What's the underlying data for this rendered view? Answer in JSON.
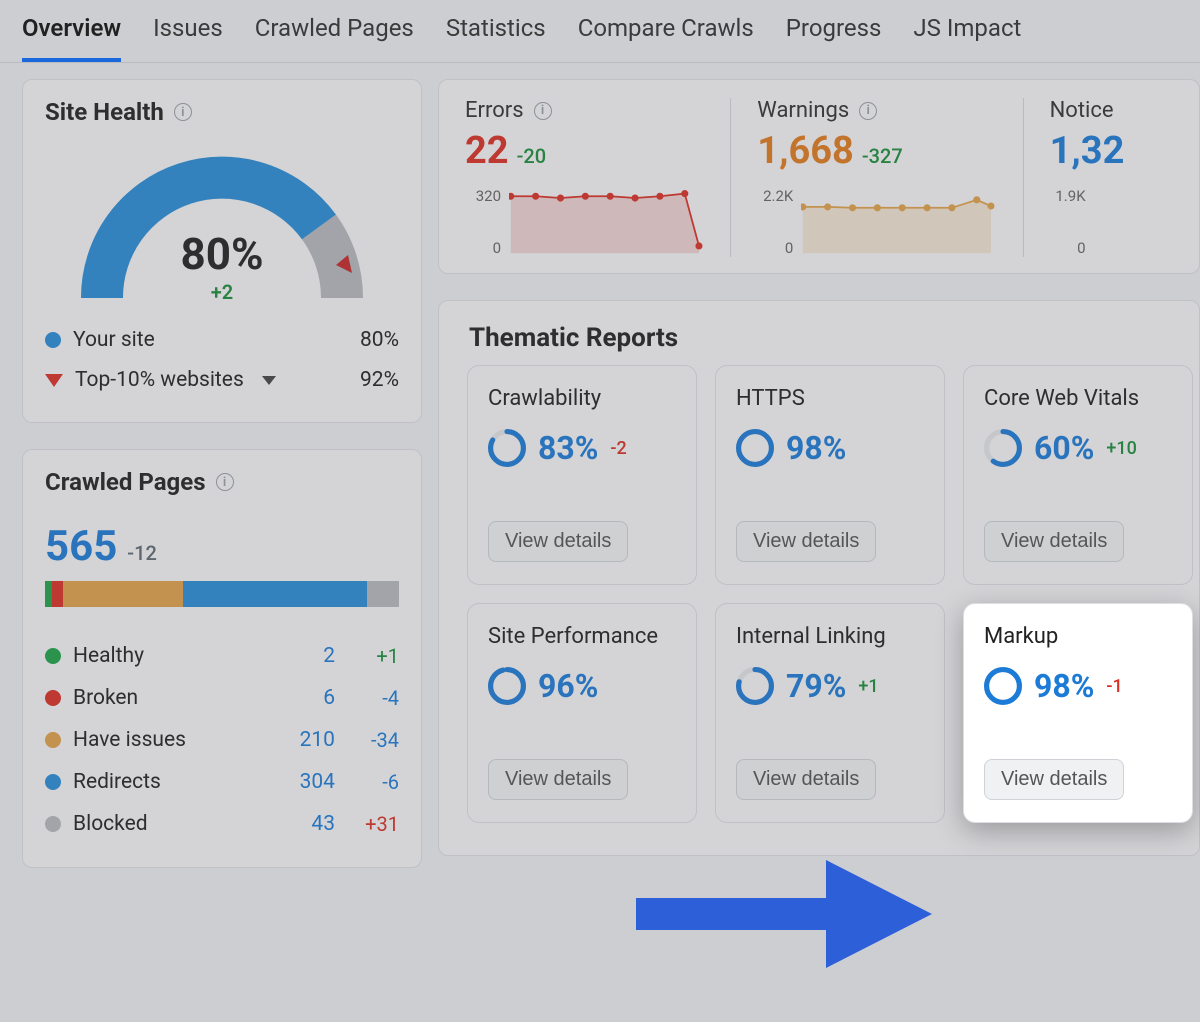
{
  "tabs": [
    "Overview",
    "Issues",
    "Crawled Pages",
    "Statistics",
    "Compare Crawls",
    "Progress",
    "JS Impact"
  ],
  "active_tab": 0,
  "site_health": {
    "title": "Site Health",
    "pct": "80%",
    "delta": "+2",
    "your_site_label": "Your site",
    "your_site_pct": "80%",
    "top10_label": "Top-10% websites",
    "top10_pct": "92%"
  },
  "strip": {
    "errors": {
      "label": "Errors",
      "value": "22",
      "delta": "-20",
      "axis_top": "320",
      "axis_bot": "0"
    },
    "warnings": {
      "label": "Warnings",
      "value": "1,668",
      "delta": "-327",
      "axis_top": "2.2K",
      "axis_bot": "0"
    },
    "notices": {
      "label": "Notice",
      "value": "1,32",
      "axis_top": "1.9K",
      "axis_bot": "0"
    }
  },
  "reports": {
    "title": "Thematic Reports",
    "button_label": "View details",
    "items": [
      {
        "title": "Crawlability",
        "pct": "83%",
        "delta": "-2",
        "delta_cls": "neg",
        "fill": 83
      },
      {
        "title": "HTTPS",
        "pct": "98%",
        "delta": "",
        "delta_cls": "",
        "fill": 98
      },
      {
        "title": "Core Web Vitals",
        "pct": "60%",
        "delta": "+10",
        "delta_cls": "pos",
        "fill": 60
      },
      {
        "title": "Site Performance",
        "pct": "96%",
        "delta": "",
        "delta_cls": "",
        "fill": 96
      },
      {
        "title": "Internal Linking",
        "pct": "79%",
        "delta": "+1",
        "delta_cls": "pos",
        "fill": 79
      },
      {
        "title": "Markup",
        "pct": "98%",
        "delta": "-1",
        "delta_cls": "neg",
        "fill": 98,
        "highlight": true
      }
    ]
  },
  "crawled": {
    "title": "Crawled Pages",
    "value": "565",
    "delta": "-12",
    "segments": [
      {
        "label": "Healthy",
        "num": "2",
        "delta": "+1",
        "delta_cls": "pos",
        "color": "#1fa34a",
        "width": 2
      },
      {
        "label": "Broken",
        "num": "6",
        "delta": "-4",
        "delta_cls": "neg",
        "color": "#d93025",
        "width": 3
      },
      {
        "label": "Have issues",
        "num": "210",
        "delta": "-34",
        "delta_cls": "neg",
        "color": "#e0a24a",
        "width": 34
      },
      {
        "label": "Redirects",
        "num": "304",
        "delta": "-6",
        "delta_cls": "neg",
        "color": "#2a8dd8",
        "width": 52
      },
      {
        "label": "Blocked",
        "num": "43",
        "delta": "+31",
        "delta_cls": "pos_red",
        "color": "#b6b9be",
        "width": 9
      }
    ]
  },
  "chart_data": [
    {
      "type": "gauge",
      "title": "Site Health",
      "value": 80,
      "benchmark": 92,
      "range": [
        0,
        100
      ],
      "delta": 2
    },
    {
      "type": "area",
      "title": "Errors",
      "ylim": [
        0,
        320
      ],
      "values": [
        300,
        300,
        295,
        300,
        300,
        295,
        300,
        310,
        40
      ],
      "color": "#d93025"
    },
    {
      "type": "area",
      "title": "Warnings",
      "ylim": [
        0,
        2200
      ],
      "values": [
        1700,
        1700,
        1680,
        1680,
        1680,
        1680,
        1680,
        1800,
        1700
      ],
      "color": "#e0a24a"
    },
    {
      "type": "stacked-bar",
      "title": "Crawled Pages",
      "total": 565,
      "series": [
        {
          "name": "Healthy",
          "value": 2
        },
        {
          "name": "Broken",
          "value": 6
        },
        {
          "name": "Have issues",
          "value": 210
        },
        {
          "name": "Redirects",
          "value": 304
        },
        {
          "name": "Blocked",
          "value": 43
        }
      ]
    }
  ]
}
